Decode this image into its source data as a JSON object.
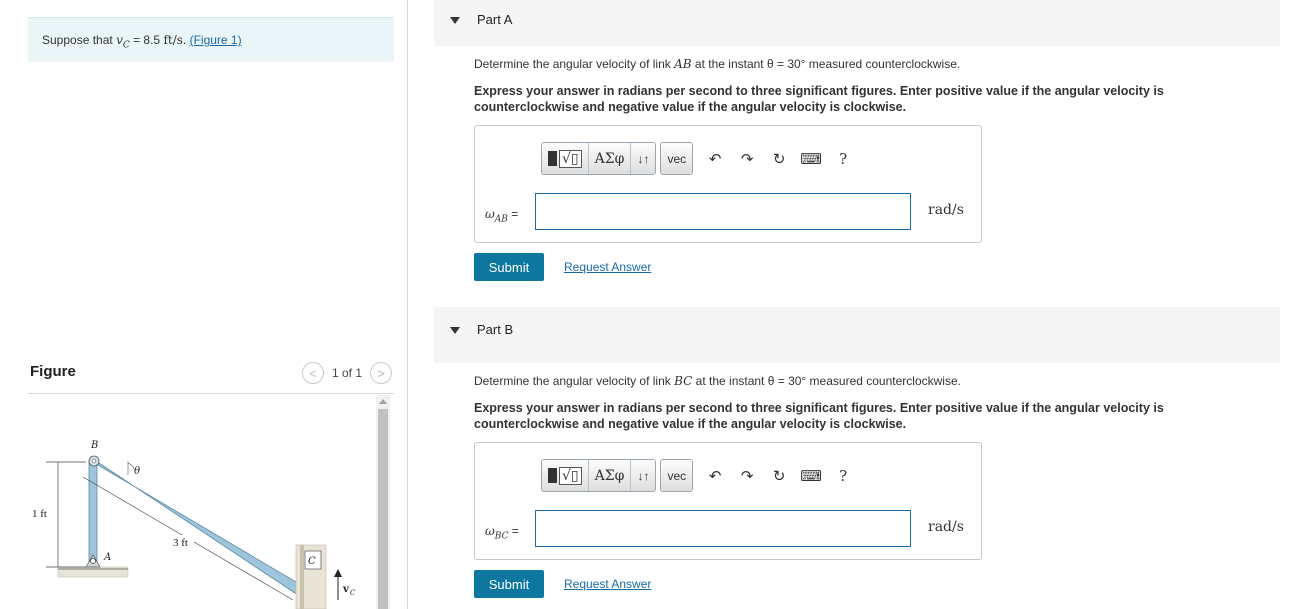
{
  "intro": {
    "prefix": "Suppose that ",
    "var": "vC",
    "equals": " = 8.5 ",
    "unit": "ft/s",
    "suffix": ". ",
    "figure_link": "(Figure 1)"
  },
  "figure_panel": {
    "title": "Figure",
    "pager_text": "1 of 1",
    "prev_symbol": "<",
    "next_symbol": ">",
    "labels": {
      "B": "B",
      "A": "A",
      "C": "C",
      "theta": "θ",
      "height": "1 ft",
      "link": "3 ft",
      "vc": "v"
    }
  },
  "parts": [
    {
      "title": "Part A",
      "question_pre": "Determine the angular velocity of link ",
      "link": "AB",
      "question_post": " at the instant θ = 30° measured counterclockwise.",
      "instruction": "Express your answer in radians per second to three significant figures. Enter positive value if the angular velocity is counterclockwise and negative value if the angular velocity is clockwise.",
      "var_symbol": "ω",
      "var_sub": "AB",
      "equals": " =",
      "input_value": "",
      "units": "rad/s",
      "submit": "Submit",
      "request": "Request Answer"
    },
    {
      "title": "Part B",
      "question_pre": "Determine the angular velocity of link ",
      "link": "BC",
      "question_post": " at the instant θ = 30° measured counterclockwise.",
      "instruction": "Express your answer in radians per second to three significant figures. Enter positive value if the angular velocity is counterclockwise and negative value if the angular velocity is clockwise.",
      "var_symbol": "ω",
      "var_sub": "BC",
      "equals": " =",
      "input_value": "",
      "units": "rad/s",
      "submit": "Submit",
      "request": "Request Answer"
    }
  ],
  "toolbar": {
    "greek": "ΑΣφ",
    "arrows": "↓↑",
    "vec": "vec",
    "help": "?",
    "icons": [
      "templates-icon",
      "undo-icon",
      "redo-icon",
      "reset-icon",
      "keyboard-icon",
      "help-icon"
    ]
  }
}
